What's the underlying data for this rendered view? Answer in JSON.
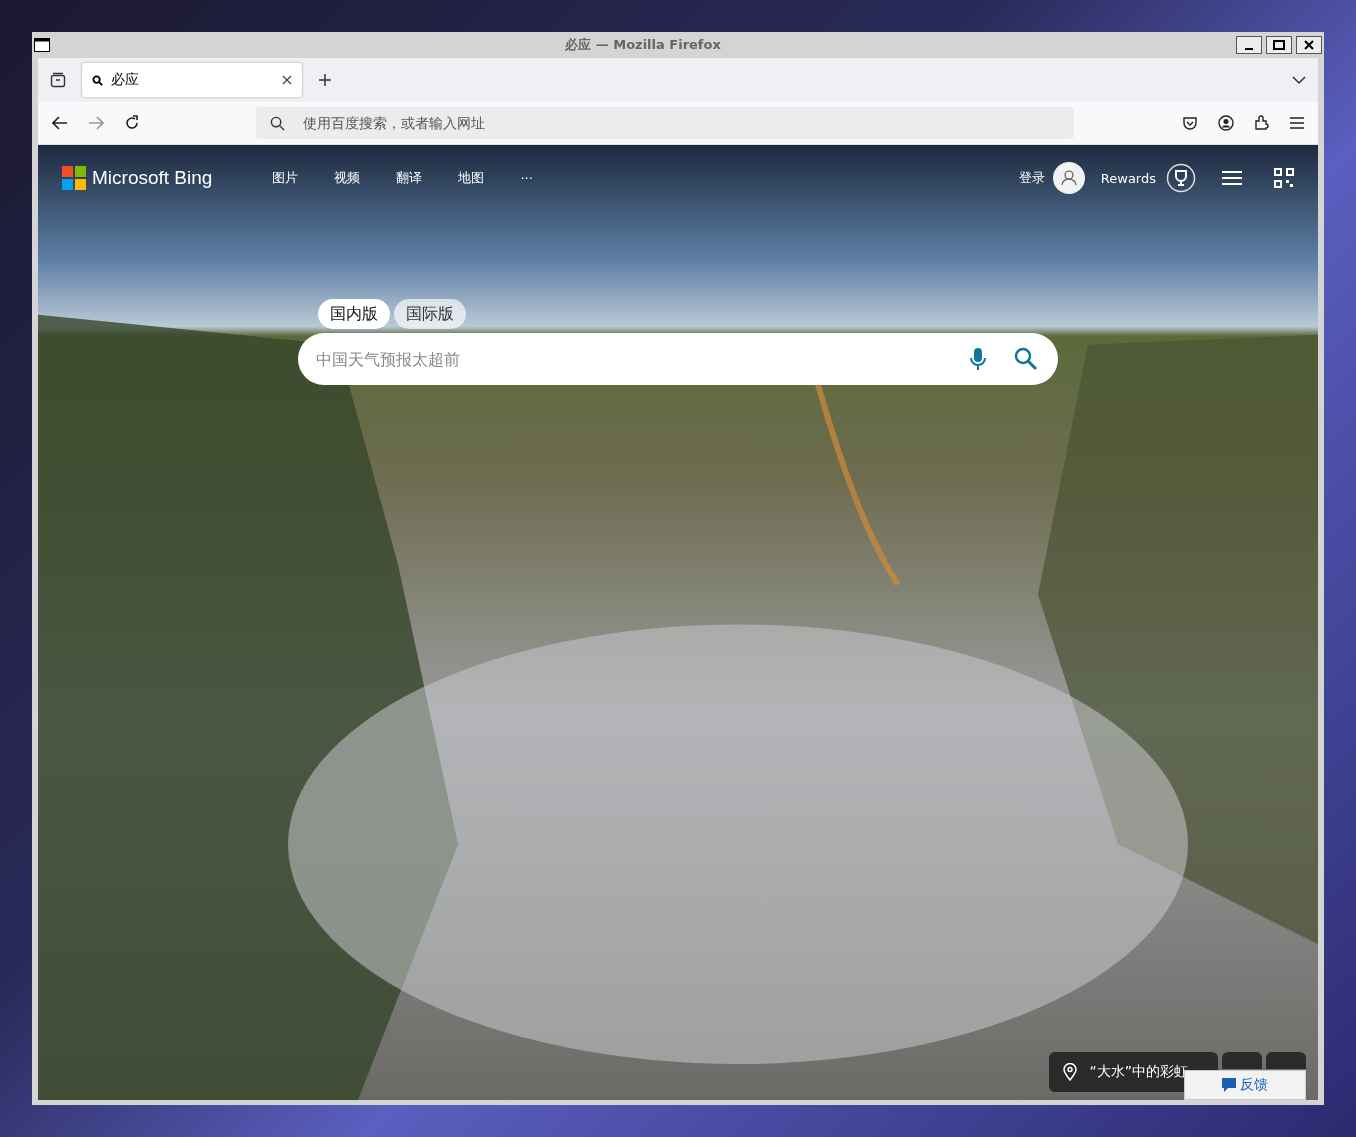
{
  "window": {
    "title": "必应 — Mozilla Firefox"
  },
  "browser_tabs": [
    {
      "title": "必应",
      "selected": true
    }
  ],
  "address_bar": {
    "placeholder": "使用百度搜索，或者输入网址"
  },
  "bing": {
    "logo": "Microsoft Bing",
    "nav": [
      {
        "label": "图片"
      },
      {
        "label": "视频"
      },
      {
        "label": "翻译"
      },
      {
        "label": "地图"
      },
      {
        "label": "···"
      }
    ],
    "sign_in": "登录",
    "rewards": "Rewards",
    "market_tabs": [
      {
        "label": "国内版",
        "selected": true
      },
      {
        "label": "国际版",
        "selected": false
      }
    ],
    "search": {
      "placeholder": "中国天气预报太超前"
    },
    "caption": "“大水”中的彩虹",
    "feedback": "反馈"
  }
}
